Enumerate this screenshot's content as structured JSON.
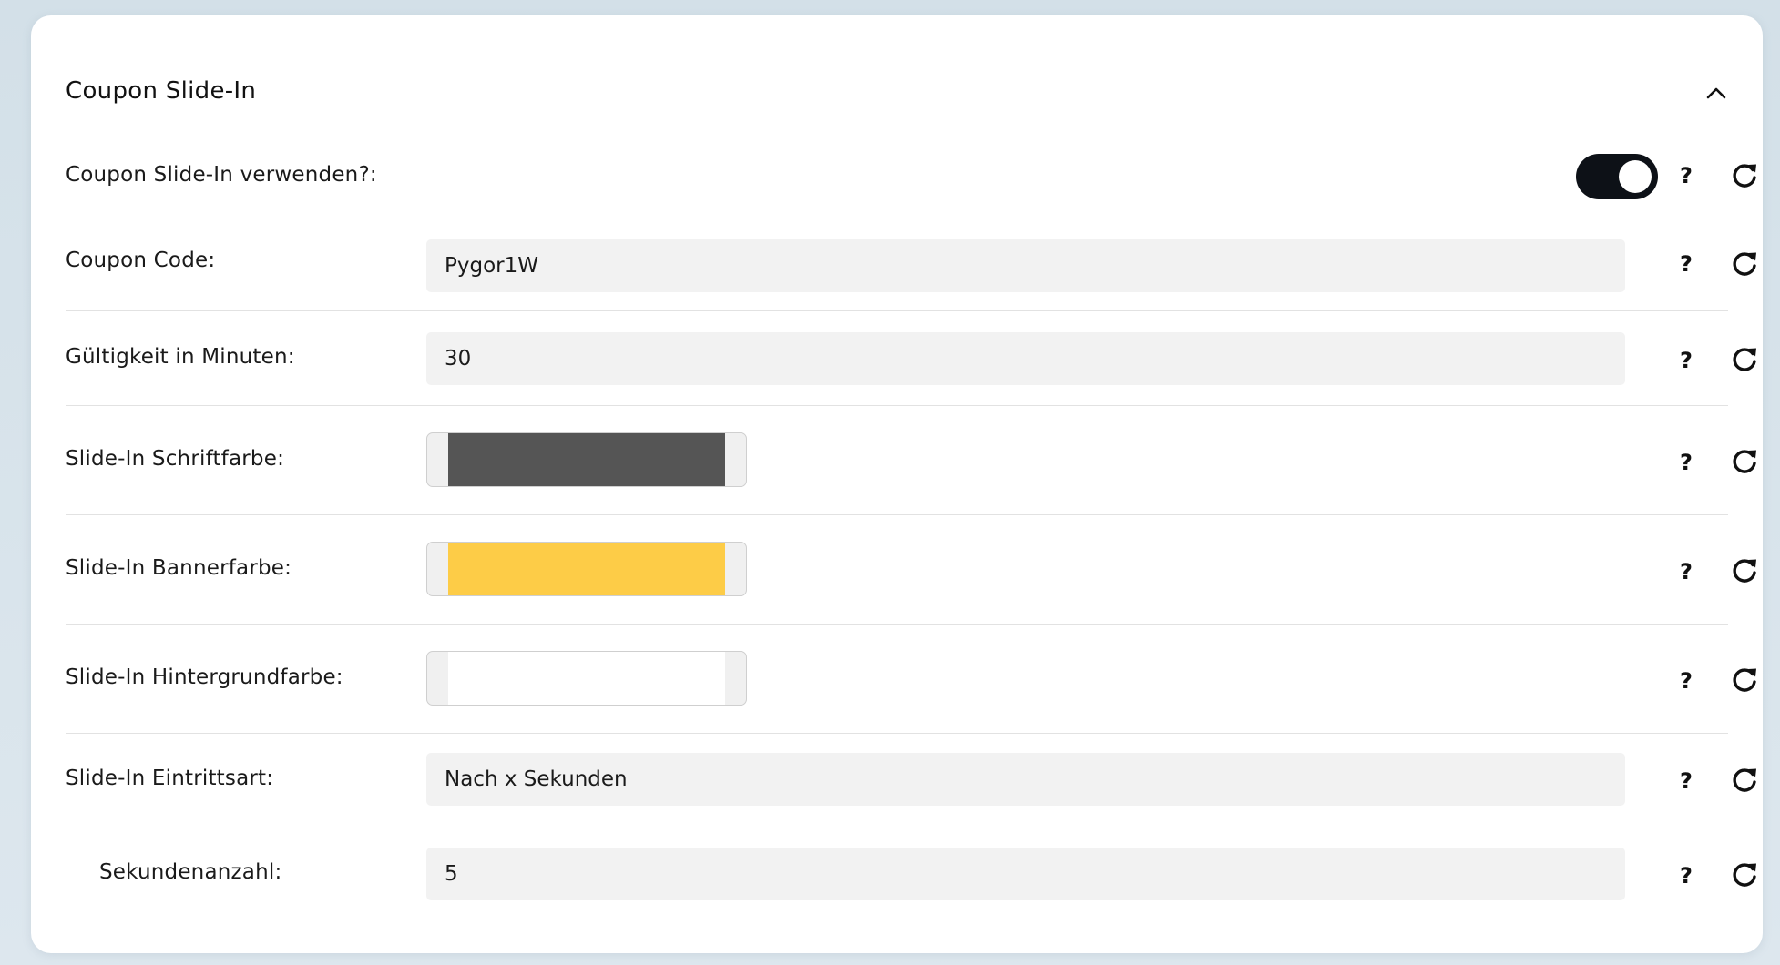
{
  "panel": {
    "title": "Coupon Slide-In"
  },
  "rows": {
    "enable": {
      "label": "Coupon Slide-In verwenden?:",
      "enabled": true
    },
    "coupon_code": {
      "label": "Coupon Code:",
      "value": "Pygor1W"
    },
    "validity": {
      "label": "Gültigkeit in Minuten:",
      "value": "30"
    },
    "font_color": {
      "label": "Slide-In Schriftfarbe:",
      "color": "#555555"
    },
    "banner_color": {
      "label": "Slide-In Bannerfarbe:",
      "color": "#fdcc47"
    },
    "background_color": {
      "label": "Slide-In Hintergrundfarbe:",
      "color": "#ffffff"
    },
    "entry_type": {
      "label": "Slide-In Eintrittsart:",
      "value": "Nach x Sekunden"
    },
    "seconds": {
      "label": "Sekundenanzahl:",
      "value": "5"
    }
  },
  "help_symbol": "?",
  "icons": {
    "collapse": "chevron-up-icon",
    "help": "question-icon",
    "reset": "reset-icon"
  }
}
